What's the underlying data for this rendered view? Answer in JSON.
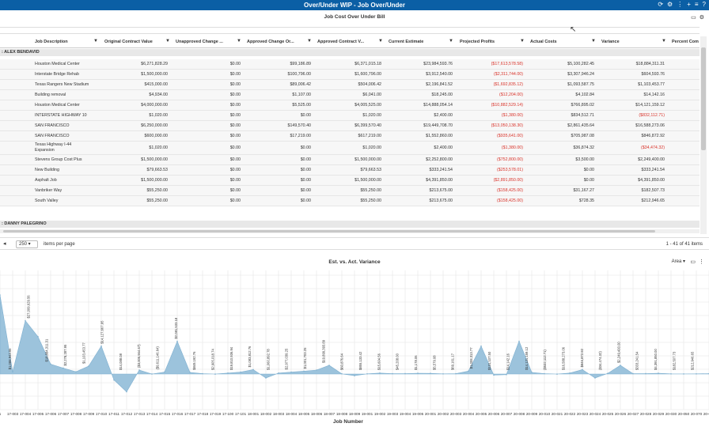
{
  "topbar": {
    "title": "Over/Under WIP - Job Over/Under",
    "icons": [
      "refresh-icon",
      "gear-icon",
      "more-icon",
      "plus-icon",
      "list-icon",
      "help-icon"
    ]
  },
  "grid": {
    "title": "Job Cost Over Under Bill",
    "columns": [
      "Job Description",
      "Original Contract Value",
      "Unapproved Change ...",
      "Approved Change Or...",
      "Approved Contract V...",
      "Current Estimate",
      "Projected Profits",
      "Actual Costs",
      "Variance",
      "Percent Com"
    ],
    "groups": [
      {
        "label": ": ALEX BENDAVID",
        "rows": [
          [
            "Houston Medical Center",
            "$6,271,828.29",
            "$0.00",
            "$99,186.89",
            "$6,371,015.18",
            "$23,984,593.76",
            "($17,613,578.58)",
            "$5,100,282.45",
            "$18,884,311.31"
          ],
          [
            "Interstate Bridge Rehab",
            "$1,500,000.00",
            "$0.00",
            "$100,796.00",
            "$1,600,796.00",
            "$3,912,540.00",
            "($2,311,744.00)",
            "$3,307,946.24",
            "$604,593.76"
          ],
          [
            "Texas Rangers New Stadium",
            "$415,000.00",
            "$0.00",
            "$89,006.42",
            "$504,006.42",
            "$2,196,841.52",
            "($1,692,835.12)",
            "$1,093,587.75",
            "$1,103,453.77"
          ],
          [
            "Building removal",
            "$4,934.00",
            "$0.00",
            "$1,107.00",
            "$6,041.00",
            "$18,245.00",
            "($12,204.00)",
            "$4,102.84",
            "$14,142.16"
          ],
          [
            "Houston Medical Center",
            "$4,000,000.00",
            "$0.00",
            "$5,525.00",
            "$4,005,525.00",
            "$14,888,054.14",
            "($10,882,529.14)",
            "$766,895.02",
            "$14,121,159.12"
          ],
          [
            "INTERSTATE HIGHWAY 10",
            "$1,020.00",
            "$0.00",
            "$0.00",
            "$1,020.00",
            "$2,400.00",
            "($1,380.00)",
            "$834,512.71",
            "($832,112.71)"
          ],
          [
            "SAN FRANCISCO",
            "$6,250,000.00",
            "$0.00",
            "$149,570.40",
            "$6,399,570.40",
            "$19,449,708.70",
            "($13,050,138.30)",
            "$2,861,435.64",
            "$16,588,273.06"
          ],
          [
            "SAN FRANCISCO",
            "$600,000.00",
            "$0.00",
            "$17,219.00",
            "$617,219.00",
            "$1,552,860.00",
            "($935,641.00)",
            "$705,987.08",
            "$846,872.92"
          ],
          [
            "Texas Highway I-44 Expansion",
            "$1,020.00",
            "$0.00",
            "$0.00",
            "$1,020.00",
            "$2,400.00",
            "($1,380.00)",
            "$36,874.32",
            "($34,474.32)"
          ],
          [
            "Stevens Group Cost Plus",
            "$1,500,000.00",
            "$0.00",
            "$0.00",
            "$1,500,000.00",
            "$2,252,800.00",
            "($752,800.00)",
            "$3,500.00",
            "$2,249,400.00"
          ],
          [
            "New Building",
            "$79,663.53",
            "$0.00",
            "$0.00",
            "$79,663.53",
            "$333,241.54",
            "($253,578.01)",
            "$0.00",
            "$333,241.54"
          ],
          [
            "Asphalt Job",
            "$1,500,000.00",
            "$0.00",
            "$0.00",
            "$1,500,000.00",
            "$4,391,850.00",
            "($2,891,850.00)",
            "$0.00",
            "$4,391,850.00"
          ],
          [
            "Vanbriker Way",
            "$55,250.00",
            "$0.00",
            "$0.00",
            "$55,250.00",
            "$213,675.00",
            "($158,425.00)",
            "$31,167.27",
            "$182,507.73"
          ],
          [
            "South Valley",
            "$55,250.00",
            "$0.00",
            "$0.00",
            "$55,250.00",
            "$213,675.00",
            "($158,425.00)",
            "$728.35",
            "$212,946.65"
          ]
        ]
      },
      {
        "label": ": DANNY PALEGRINO",
        "rows": []
      }
    ]
  },
  "pager": {
    "page_size": "250",
    "items_per_page": "items per page",
    "count": "1 - 41 of 41 items"
  },
  "chart_panel": {
    "title": "Est. vs. Act. Variance",
    "type_selector": "Area ▾"
  },
  "chart_data": {
    "type": "area",
    "xlabel": "Job Number",
    "ylabel": "",
    "x": [
      "1",
      "17-003",
      "17-004",
      "17-005",
      "17-006",
      "17-007",
      "17-008",
      "17-009",
      "17-010",
      "17-011",
      "17-012",
      "17-013",
      "17-014",
      "17-015",
      "17-016",
      "17-017",
      "17-018",
      "17-019",
      "17-100",
      "17-101",
      "18-001",
      "18-002",
      "18-003",
      "18-004",
      "18-005",
      "18-006",
      "18-007",
      "18-008",
      "18-009",
      "19-001",
      "19-002",
      "19-003",
      "19-004",
      "19-005",
      "20-001",
      "20-002",
      "20-003",
      "20-004",
      "20-005",
      "20-006",
      "20-007",
      "20-008",
      "20-009",
      "20-010",
      "20-021",
      "20-022",
      "20-023",
      "20-024",
      "20-025",
      "20-026",
      "20-027",
      "20-028",
      "20-029",
      "20-030",
      "20-050",
      "20-070",
      "20-071"
    ],
    "values": [
      40000000,
      1088943,
      27000000,
      18884311,
      5000000,
      3000000,
      1103454,
      4000000,
      14121159,
      -3005944,
      -9000000,
      2000000,
      14142,
      1000000,
      16588273,
      846873,
      200000,
      -34474,
      500000,
      1000000,
      2249400,
      -2000000,
      500000,
      1000000,
      1450925,
      2000000,
      4391850,
      100000,
      -832113,
      100000,
      500000,
      182508,
      212947,
      400000,
      333242,
      100000,
      200000,
      1500000,
      14121159,
      -533000,
      -300000,
      16588273,
      846873,
      200000,
      -34474,
      500000,
      2249400,
      -2000000,
      333242,
      4391850,
      182508,
      212947,
      400000,
      100000,
      50000,
      100000,
      200000
    ],
    "data_labels": [
      "$1,088,943.55",
      "$27,009,629.56",
      "$18,884,311.31",
      "$2,278,287.95",
      "$1,103,453.77",
      "$14,127,667.95",
      "$14,088.08",
      "($3,005,944.57)",
      "($9,611,146.64)",
      "$2,081,533.18",
      "$849,192.76",
      "$2,905,018.74",
      "$19,810,936.94",
      "$1,083,812.76",
      "$1,060,892.78",
      "$2,977,039.25",
      "$1,001,703.25",
      "$19,899,393.89",
      "$60,876.64",
      "$855,133.42",
      "$15,604.56",
      "$45,208.00",
      "$1,178.06",
      "$5,579.08",
      "$69,161.17",
      "$1,008,313.77",
      "$131,107.50",
      "$14,142.16",
      "$14,121,159.12",
      "($532,112.71)",
      "$16,588,273.06",
      "$846,872.92",
      "($34,474.32)",
      "$2,249,400.00",
      "$333,241.54",
      "$4,391,850.00",
      "$182,507.73",
      "$212,946.65"
    ],
    "grid": true
  }
}
